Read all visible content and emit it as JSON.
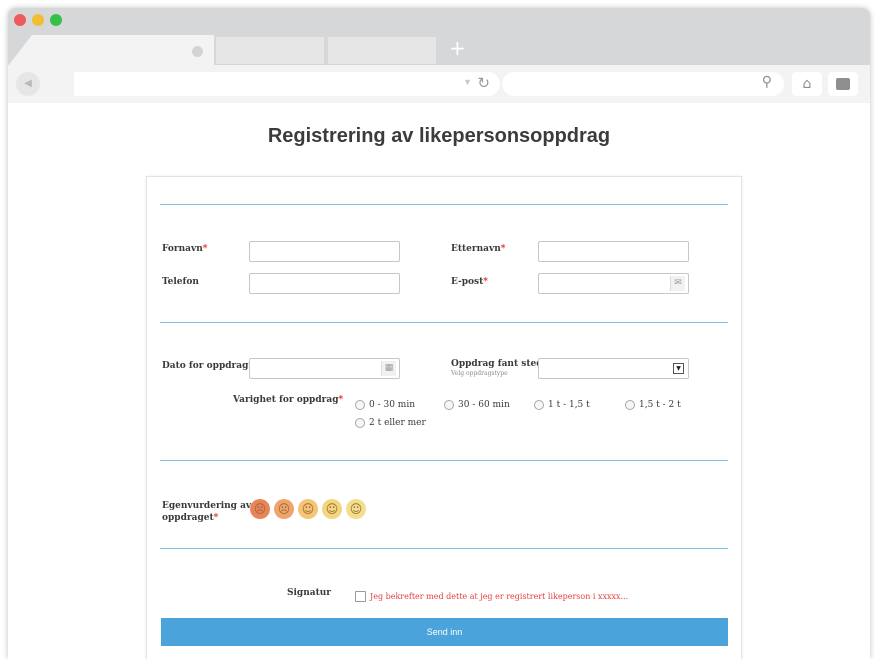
{
  "browser": {
    "tab_plus": "+",
    "url": "",
    "search": ""
  },
  "page": {
    "title": "Registrering av likepersonsoppdrag"
  },
  "form": {
    "fornavn_label": "Fornavn",
    "etternavn_label": "Etternavn",
    "telefon_label": "Telefon",
    "epost_label": "E-post",
    "dato_label": "Dato for oppdrag",
    "sted_label": "Oppdrag fant sted",
    "sted_sublabel": "Velg oppdragstype",
    "varighet_label": "Varighet for oppdrag",
    "varighet_options": [
      "0 - 30 min",
      "30 - 60 min",
      "1 t - 1,5 t",
      "1,5 t - 2 t",
      "2 t eller mer"
    ],
    "egenvurdering_label_1": "Egenvurdering av",
    "egenvurdering_label_2": "oppdraget",
    "signatur_label": "Signatur",
    "signatur_confirm": "Jeg bekrefter med dette at jeg er registrert likeperson i xxxxx...",
    "submit_label": "Send inn",
    "required_mark": "*"
  },
  "icons": {
    "email": "envelope-icon",
    "calendar": "calendar-icon",
    "select": "select-arrow-icon",
    "rating": [
      "very-sad-face-icon",
      "sad-face-icon",
      "neutral-face-icon",
      "smile-face-icon",
      "happy-face-icon"
    ]
  },
  "colors": {
    "accent": "#4aa3db",
    "divider": "#7cc4e4",
    "required": "#e32a2a",
    "rating": [
      "#e9835a",
      "#f0a46d",
      "#f4c477",
      "#f2d57d",
      "#f3de8e"
    ]
  }
}
